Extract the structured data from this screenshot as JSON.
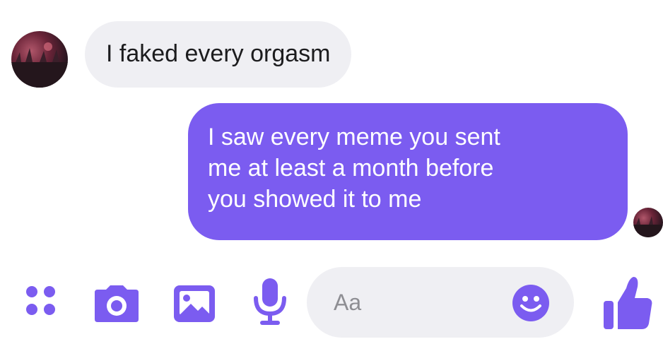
{
  "conversation": {
    "messages": [
      {
        "sender": "other",
        "text": "I faked every orgasm"
      },
      {
        "sender": "me",
        "lines": [
          "I saw every meme you sent",
          "me at least a month before",
          "you showed it to me"
        ]
      }
    ]
  },
  "composer": {
    "placeholder": "Aa",
    "icons": [
      "apps-icon",
      "camera-icon",
      "gallery-icon",
      "microphone-icon",
      "emoji-icon",
      "thumbs-up-icon"
    ]
  },
  "colors": {
    "accent": "#7b5cf0",
    "received_bubble": "#efeff3",
    "received_text": "#1c1c1e",
    "sent_text": "#ffffff"
  }
}
